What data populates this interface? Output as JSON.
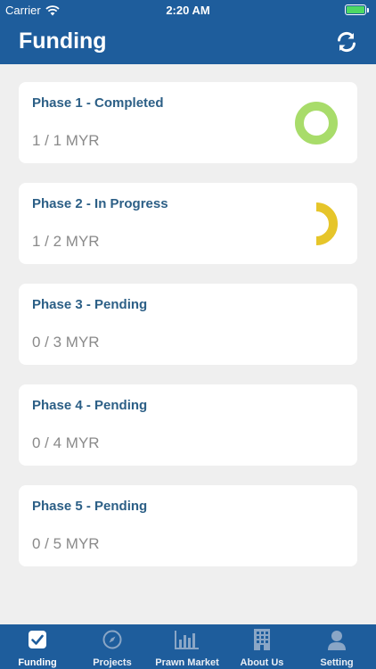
{
  "status_bar": {
    "carrier": "Carrier",
    "time": "2:20 AM",
    "battery_color": "#4cd964"
  },
  "header": {
    "title": "Funding",
    "refresh_icon": "refresh-icon",
    "background_color": "#1e5d9c"
  },
  "phases": [
    {
      "title": "Phase 1 - Completed",
      "amount": "1 / 1 MYR",
      "progress": 1.0,
      "ring_color": "#a8dc6a"
    },
    {
      "title": "Phase 2 - In Progress",
      "amount": "1 / 2 MYR",
      "progress": 0.5,
      "ring_color": "#e6c52a"
    },
    {
      "title": "Phase 3 - Pending",
      "amount": "0 / 3 MYR",
      "progress": 0
    },
    {
      "title": "Phase 4 - Pending",
      "amount": "0 / 4 MYR",
      "progress": 0
    },
    {
      "title": "Phase 5 - Pending",
      "amount": "0 / 5 MYR",
      "progress": 0
    }
  ],
  "tab_bar": {
    "tabs": [
      {
        "label": "Funding",
        "icon": "checkbox-icon",
        "active": true
      },
      {
        "label": "Projects",
        "icon": "compass-icon",
        "active": false
      },
      {
        "label": "Prawn Market",
        "icon": "bar-chart-icon",
        "active": false
      },
      {
        "label": "About Us",
        "icon": "building-icon",
        "active": false
      },
      {
        "label": "Setting",
        "icon": "user-icon",
        "active": false
      }
    ]
  }
}
